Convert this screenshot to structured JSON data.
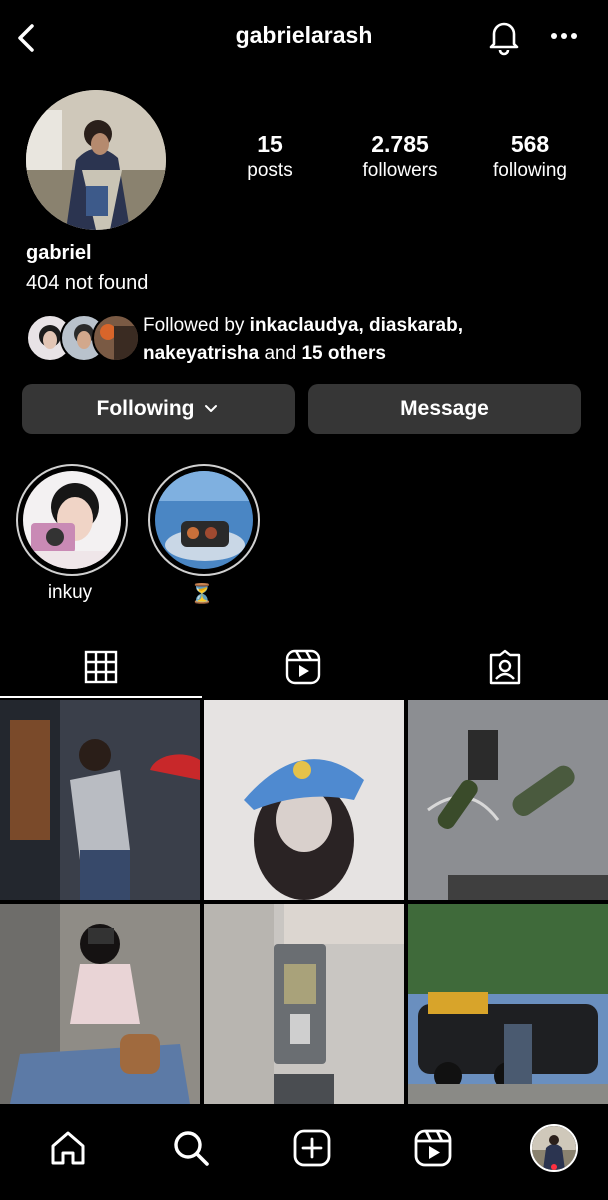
{
  "header": {
    "username": "gabrielarash"
  },
  "profile": {
    "stats": [
      {
        "value": "15",
        "label": "posts"
      },
      {
        "value": "2.785",
        "label": "followers"
      },
      {
        "value": "568",
        "label": "following"
      }
    ],
    "display_name": "gabriel",
    "bio": "404 not found",
    "followed_by": {
      "prefix": "Followed by ",
      "names_line1": "inkaclaudya, diaskarab,",
      "name3": "nakeyatrisha",
      "and": " and ",
      "others": "15 others"
    }
  },
  "buttons": {
    "following": "Following",
    "message": "Message"
  },
  "highlights": [
    {
      "label": "inkuy"
    },
    {
      "label": "⏳"
    }
  ],
  "tabs": [
    "grid-icon",
    "reels-icon",
    "tagged-icon"
  ],
  "nav": [
    "home-icon",
    "search-icon",
    "create-icon",
    "reels-icon",
    "profile-avatar"
  ],
  "colors": {
    "background": "#000000",
    "button": "#363636",
    "notification_dot": "#ff3040"
  }
}
